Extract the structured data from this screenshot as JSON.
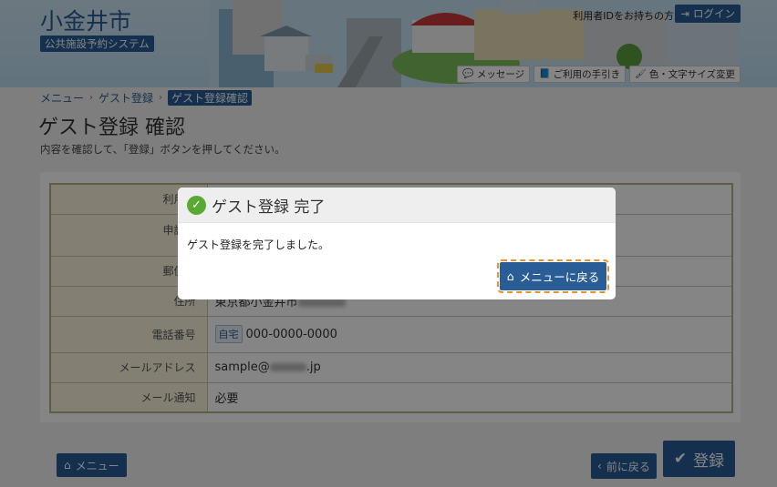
{
  "header": {
    "city_name": "小金井市",
    "system_name": "公共施設予約システム",
    "login_note": "利用者IDをお持ちの方",
    "login_label": "ログイン",
    "tools": [
      {
        "icon": "speech-bubble-icon",
        "label": "メッセージ"
      },
      {
        "icon": "book-icon",
        "label": "ご利用の手引き"
      },
      {
        "icon": "brush-icon",
        "label": "色・文字サイズ変更"
      }
    ]
  },
  "breadcrumb": {
    "items": [
      "メニュー",
      "ゲスト登録"
    ],
    "current": "ゲスト登録確認"
  },
  "page": {
    "title": "ゲスト登録 確認",
    "description": "内容を確認して、「登録」ボタンを押してください。"
  },
  "table": {
    "rows": [
      {
        "label": "利用者",
        "value": ""
      },
      {
        "label": "申請者",
        "value": ""
      },
      {
        "label": "郵便番",
        "value": ""
      },
      {
        "label": "住所",
        "value": "東京都小金井市"
      },
      {
        "label": "電話番号",
        "tag": "自宅",
        "value": "000-0000-0000"
      },
      {
        "label": "メールアドレス",
        "value_pre": "sample@",
        "value_post": ".jp"
      },
      {
        "label": "メール通知",
        "value": "必要"
      }
    ]
  },
  "footer": {
    "menu_label": "メニュー",
    "back_label": "前に戻る",
    "register_label": "登録"
  },
  "modal": {
    "title": "ゲスト登録 完了",
    "message": "ゲスト登録を完了しました。",
    "return_label": "メニューに戻る"
  },
  "colors": {
    "primary": "#2a5d96",
    "success": "#5aa932",
    "focus_outline": "#e8922b",
    "label_bg": "#fbf6dc"
  }
}
